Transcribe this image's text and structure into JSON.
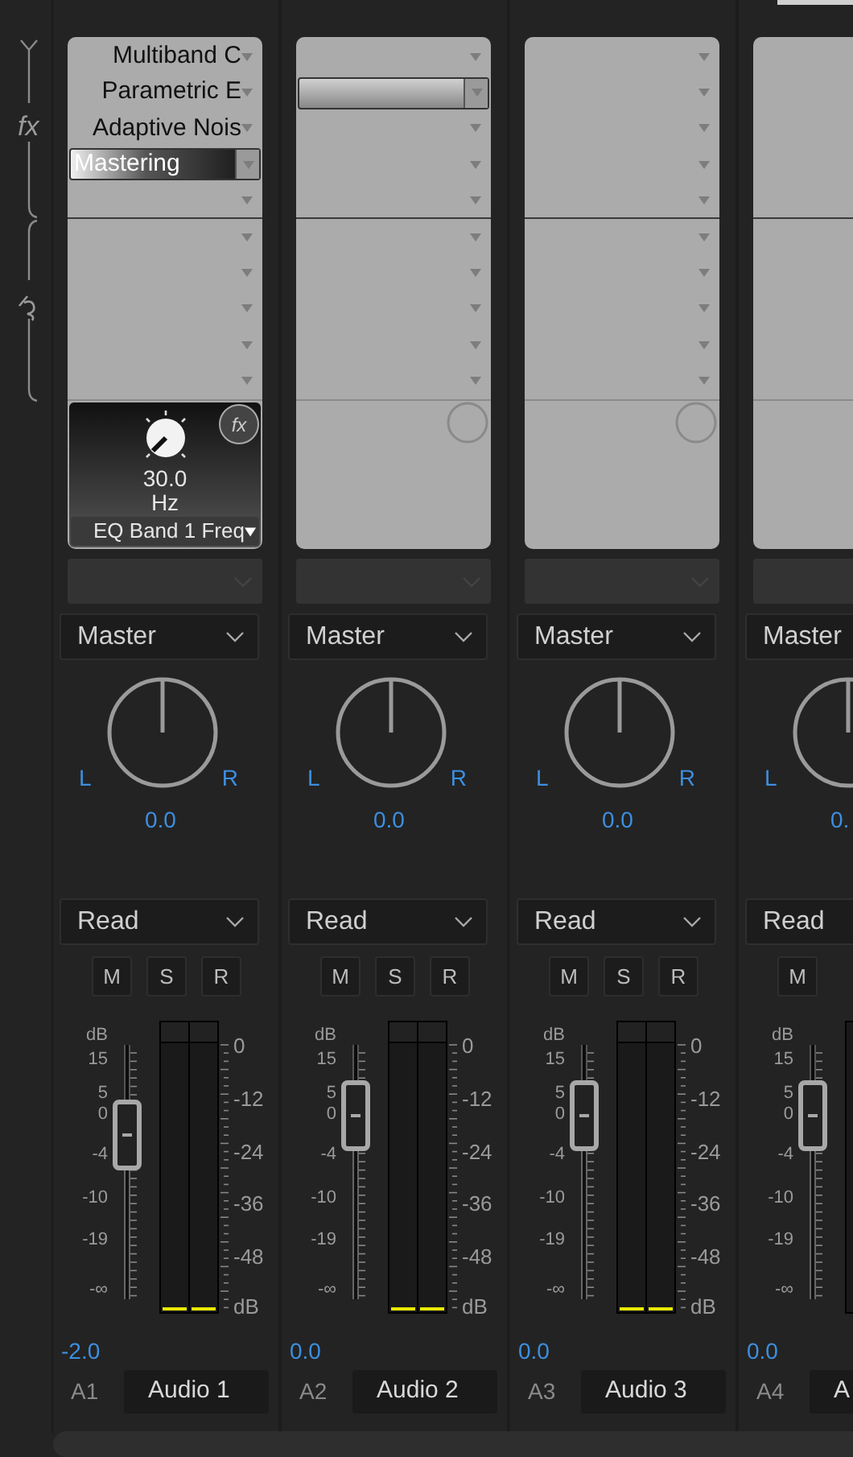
{
  "sidebar": {
    "fx_label": "fx"
  },
  "channels": [
    {
      "effects": [
        {
          "name": "Multiband C",
          "selected": false
        },
        {
          "name": "Parametric E",
          "selected": false
        },
        {
          "name": "Adaptive Nois",
          "selected": false
        },
        {
          "name": "Mastering",
          "selected": true
        },
        {
          "selected": false
        }
      ],
      "sends": [
        {
          "selected": false
        },
        {
          "selected": false
        },
        {
          "selected": false
        },
        {
          "selected": false
        },
        {
          "selected": false
        }
      ],
      "parameter": {
        "value": "30.0",
        "unit": "Hz",
        "name": "EQ Band 1 Freq",
        "bypass_label": "fx"
      },
      "output": "Master",
      "pan": {
        "left": "L",
        "right": "R",
        "value": "0.0",
        "level": 0.5
      },
      "automation": "Read",
      "buttons": [
        {
          "label": "M"
        },
        {
          "label": "S"
        },
        {
          "label": "R"
        }
      ],
      "fader": {
        "unit": "dB",
        "scale": [
          "15",
          "5",
          "0",
          "-4",
          "-10",
          "-19",
          "-∞"
        ],
        "level": 0.64,
        "value": "-2.0"
      },
      "meter": {
        "scale": [
          "0",
          "-12",
          "-24",
          "-36",
          "-48",
          "dB"
        ],
        "channels": [
          {
            "level": 0.02
          },
          {
            "level": 0.02
          }
        ]
      },
      "track_id": "A1",
      "track_name": "Audio 1"
    },
    {
      "effects": [
        {
          "selected": false
        },
        {
          "selected": true
        },
        {
          "selected": false
        },
        {
          "selected": false
        },
        {
          "selected": false
        }
      ],
      "sends": [
        {
          "selected": false
        },
        {
          "selected": false
        },
        {
          "selected": false
        },
        {
          "selected": false
        },
        {
          "selected": false
        }
      ],
      "output": "Master",
      "pan": {
        "left": "L",
        "right": "R",
        "value": "0.0",
        "level": 0.5
      },
      "automation": "Read",
      "buttons": [
        {
          "label": "M"
        },
        {
          "label": "S"
        },
        {
          "label": "R"
        }
      ],
      "fader": {
        "unit": "dB",
        "scale": [
          "15",
          "5",
          "0",
          "-4",
          "-10",
          "-19",
          "-∞"
        ],
        "level": 0.72,
        "value": "0.0"
      },
      "meter": {
        "scale": [
          "0",
          "-12",
          "-24",
          "-36",
          "-48",
          "dB"
        ],
        "channels": [
          {
            "level": 0.02
          },
          {
            "level": 0.02
          }
        ]
      },
      "track_id": "A2",
      "track_name": "Audio 2"
    },
    {
      "effects": [
        {
          "selected": false
        },
        {
          "selected": false
        },
        {
          "selected": false
        },
        {
          "selected": false
        },
        {
          "selected": false
        }
      ],
      "sends": [
        {
          "selected": false
        },
        {
          "selected": false
        },
        {
          "selected": false
        },
        {
          "selected": false
        },
        {
          "selected": false
        }
      ],
      "output": "Master",
      "pan": {
        "left": "L",
        "right": "R",
        "value": "0.0",
        "level": 0.5
      },
      "automation": "Read",
      "buttons": [
        {
          "label": "M"
        },
        {
          "label": "S"
        },
        {
          "label": "R"
        }
      ],
      "fader": {
        "unit": "dB",
        "scale": [
          "15",
          "5",
          "0",
          "-4",
          "-10",
          "-19",
          "-∞"
        ],
        "level": 0.72,
        "value": "0.0"
      },
      "meter": {
        "scale": [
          "0",
          "-12",
          "-24",
          "-36",
          "-48",
          "dB"
        ],
        "channels": [
          {
            "level": 0.02
          },
          {
            "level": 0.02
          }
        ]
      },
      "track_id": "A3",
      "track_name": "Audio 3"
    },
    {
      "output": "Master",
      "pan": {
        "left": "L",
        "value": "0.",
        "level": 0.5
      },
      "automation": "Read",
      "buttons": [
        {
          "label": "M"
        }
      ],
      "fader": {
        "unit": "dB",
        "scale": [
          "15",
          "5",
          "0",
          "-4",
          "-10",
          "-19",
          "-∞"
        ],
        "level": 0.72,
        "value": "0.0"
      },
      "track_id": "A4",
      "track_name": "A"
    }
  ]
}
